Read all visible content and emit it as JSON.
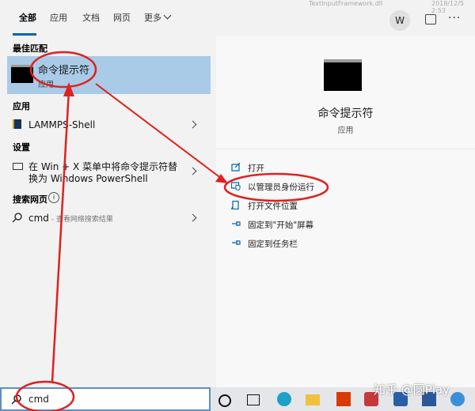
{
  "tabs": [
    {
      "label": "全部"
    },
    {
      "label": "应用"
    },
    {
      "label": "文档"
    },
    {
      "label": "网页"
    },
    {
      "label": "更多"
    }
  ],
  "background_text": {
    "file": "TextInputFramework.dll",
    "date": "2018/12/5 2:53"
  },
  "avatar_letter": "W",
  "more_dots": "···",
  "left": {
    "best_match_header": "最佳匹配",
    "best_match": {
      "title": "命令提示符",
      "subtitle": "应用"
    },
    "apps_header": "应用",
    "apps": [
      {
        "label": "LAMMPS-Shell"
      }
    ],
    "settings_header": "设置",
    "settings": [
      {
        "line1": "在 Win + X 菜单中将命令提示符替",
        "line2": "换为 Windows PowerShell"
      }
    ],
    "web_header": "搜索网页",
    "web_help": "i",
    "web": {
      "query": "cmd",
      "suffix": " - 查看网络搜索结果"
    }
  },
  "right": {
    "title": "命令提示符",
    "subtitle": "应用",
    "actions": [
      {
        "label": "打开",
        "icon": "open-icon"
      },
      {
        "label": "以管理员身份运行",
        "icon": "run-as-admin-icon"
      },
      {
        "label": "打开文件位置",
        "icon": "file-location-icon"
      },
      {
        "label": "固定到\"开始\"屏幕",
        "icon": "pin-icon"
      },
      {
        "label": "固定到任务栏",
        "icon": "pin-icon"
      }
    ]
  },
  "search": {
    "value": "cmd"
  },
  "watermark": "知乎 @圆Play",
  "colors": {
    "highlight": "#a9cbe8",
    "accent": "#0063b1",
    "annotation": "#e02020"
  }
}
